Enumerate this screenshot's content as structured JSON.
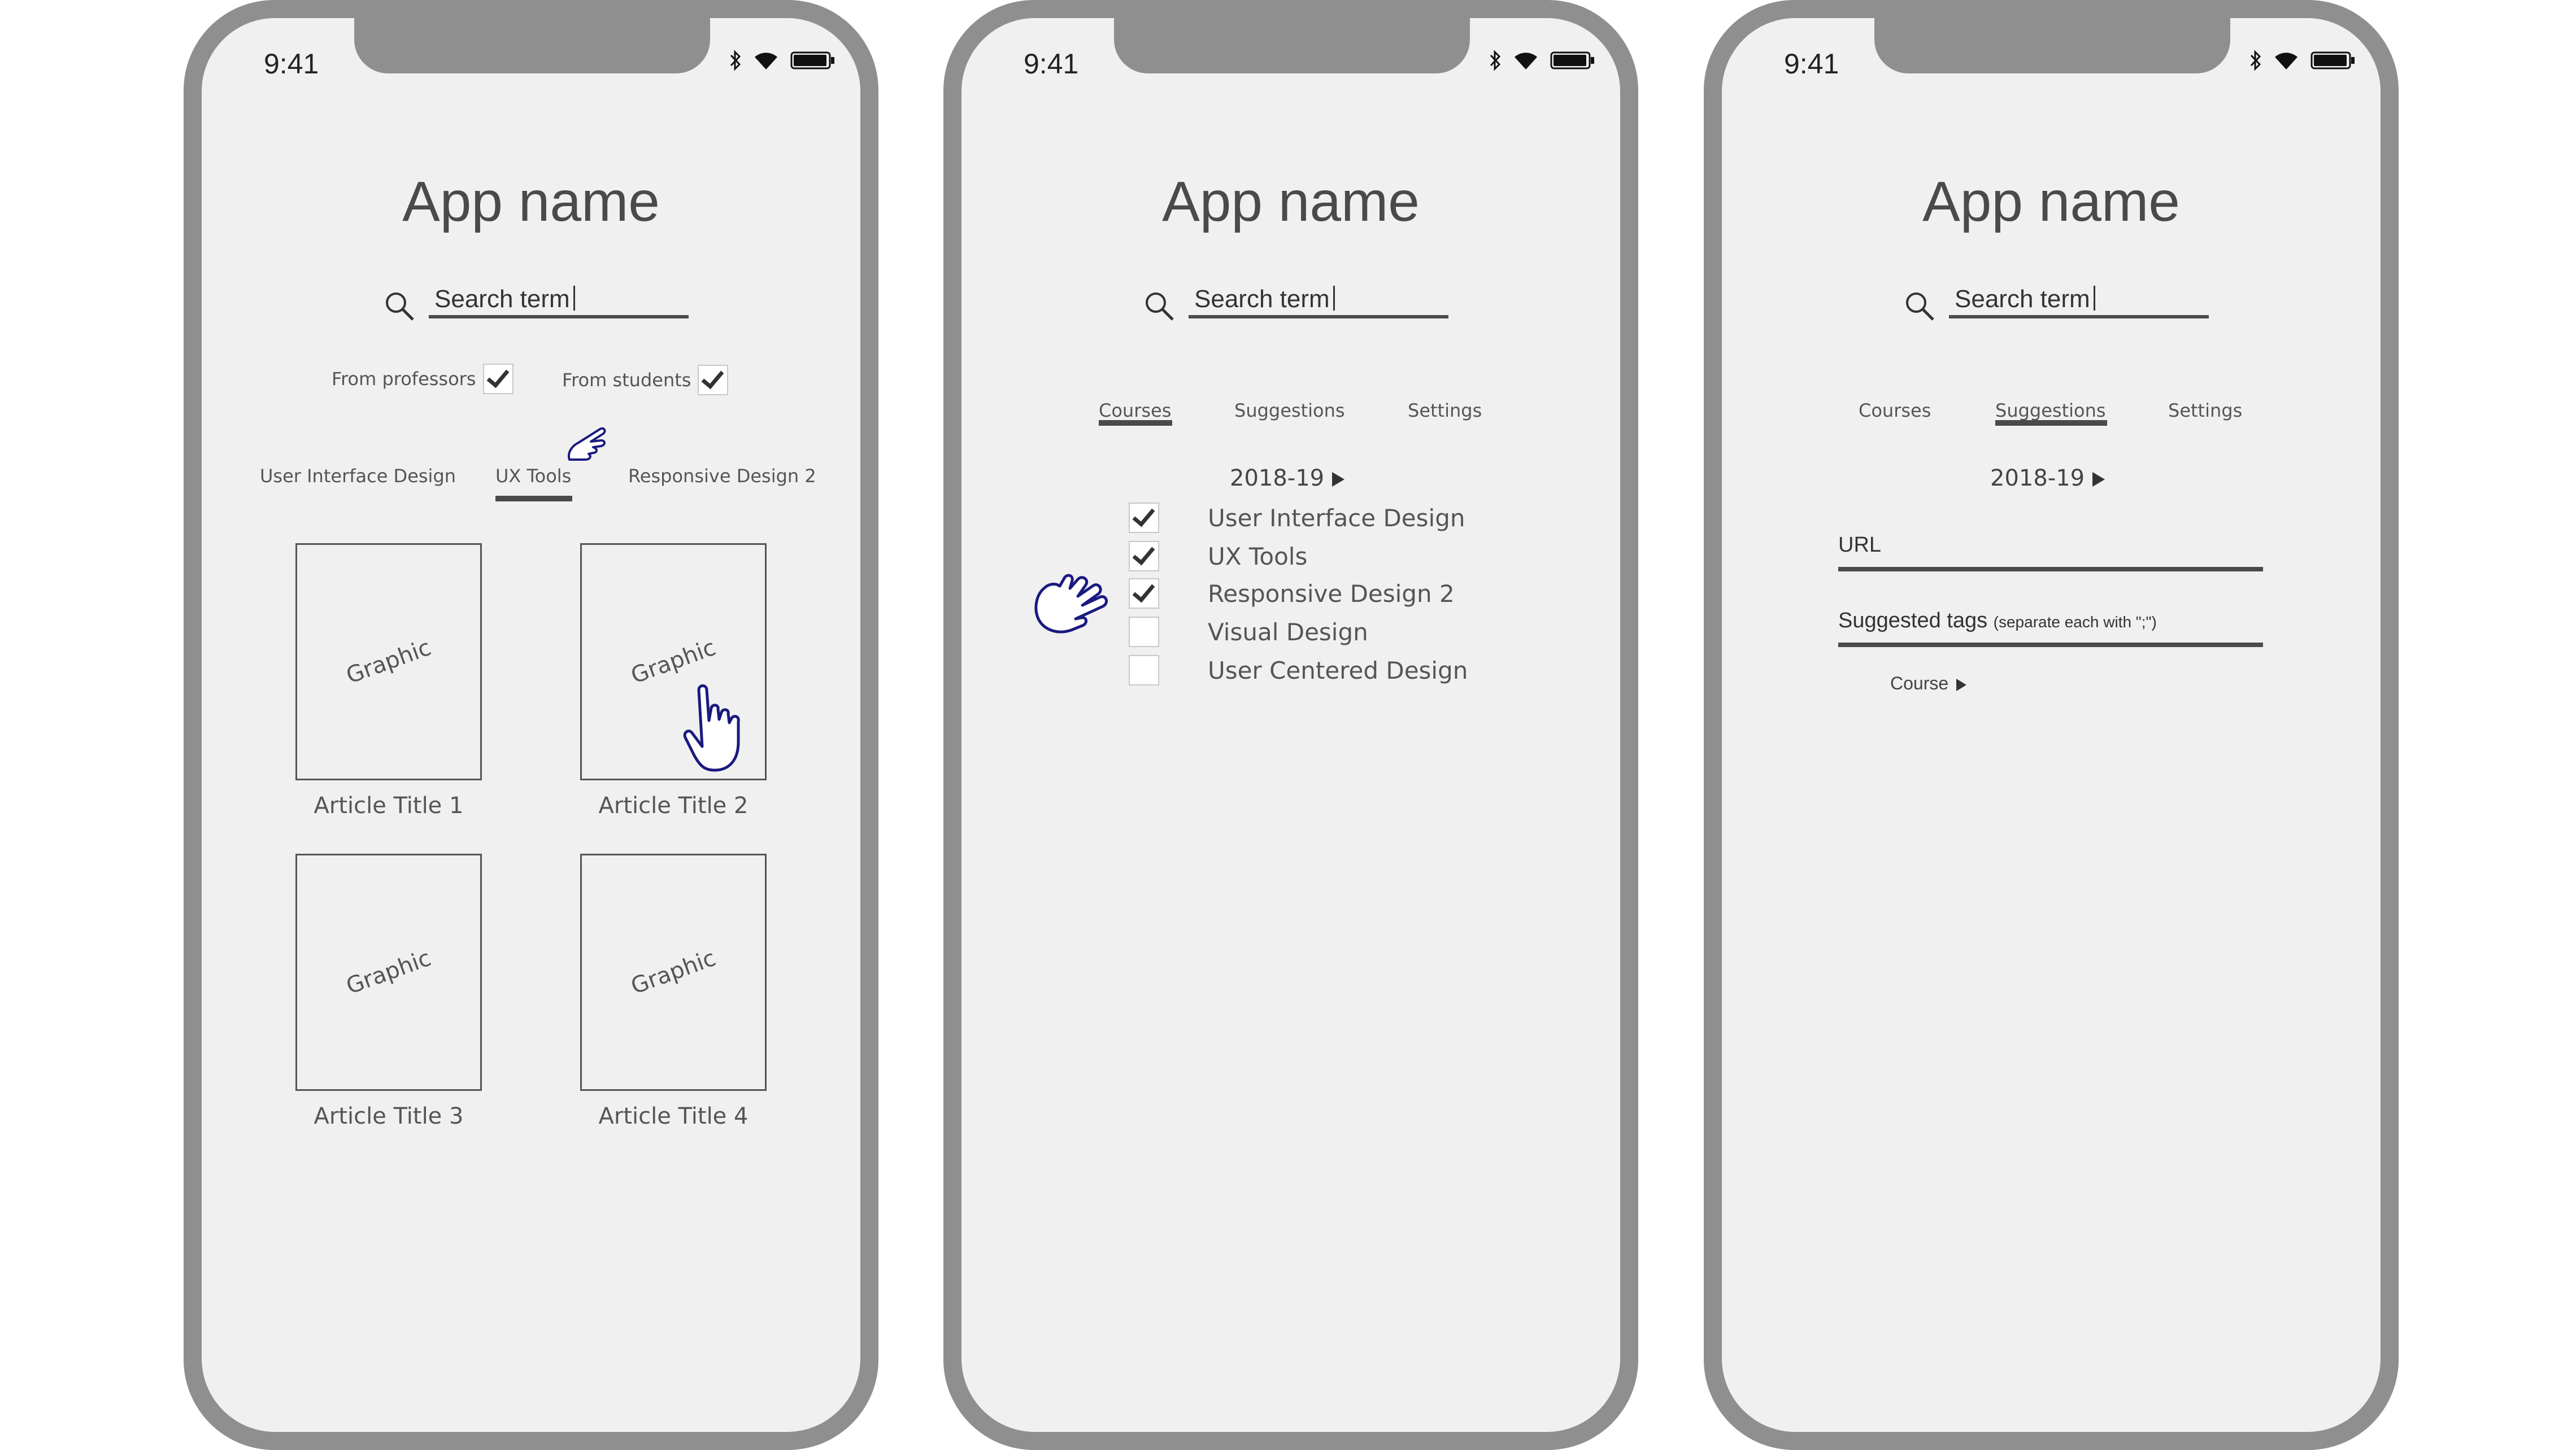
{
  "phones": [
    {
      "time": "9:41",
      "app_name": "App name",
      "search": {
        "value": "Search term"
      },
      "filters": [
        {
          "label": "From professors",
          "checked": true
        },
        {
          "label": "From students",
          "checked": true
        }
      ],
      "tabs": [
        "User Interface Design",
        "UX Tools",
        "Responsive Design 2"
      ],
      "active_tab": "UX Tools",
      "articles": [
        {
          "graphic": "Graphic",
          "title": "Article Title 1"
        },
        {
          "graphic": "Graphic",
          "title": "Article Title 2"
        },
        {
          "graphic": "Graphic",
          "title": "Article Title 3"
        },
        {
          "graphic": "Graphic",
          "title": "Article Title 4"
        }
      ]
    },
    {
      "time": "9:41",
      "app_name": "App name",
      "search": {
        "value": "Search term"
      },
      "tabs": [
        "Courses",
        "Suggestions",
        "Settings"
      ],
      "active_tab": "Courses",
      "year": "2018-19",
      "courses": [
        {
          "label": "User Interface Design",
          "checked": true
        },
        {
          "label": "UX Tools",
          "checked": true
        },
        {
          "label": "Responsive Design 2",
          "checked": true
        },
        {
          "label": "Visual Design",
          "checked": false
        },
        {
          "label": "User Centered Design",
          "checked": false
        }
      ]
    },
    {
      "time": "9:41",
      "app_name": "App name",
      "search": {
        "value": "Search term"
      },
      "tabs": [
        "Courses",
        "Suggestions",
        "Settings"
      ],
      "active_tab": "Suggestions",
      "year": "2018-19",
      "url_label": "URL",
      "tags_label": "Suggested tags",
      "tags_hint": "(separate each with \";\")",
      "course_label": "Course"
    }
  ],
  "colors": {
    "frame": "#8f8f8f",
    "screen": "#f0f0f0",
    "pointer": "#1a1a80"
  }
}
